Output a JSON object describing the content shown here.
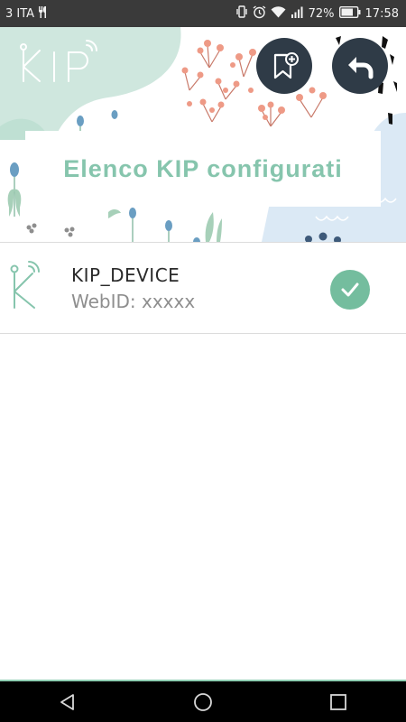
{
  "status_bar": {
    "carrier": "3 ITA",
    "battery": "72%",
    "time": "17:58"
  },
  "header": {
    "logo_text": "KIP",
    "title": "Elenco KIP configurati"
  },
  "devices": [
    {
      "name": "KIP_DEVICE",
      "webid_label": "WebID:",
      "webid_value": "xxxxx",
      "configured": true
    }
  ],
  "colors": {
    "accent": "#86c5ad",
    "check": "#74bd9e",
    "button_bg": "#2f3b47",
    "status_bar": "#3a3a3a"
  },
  "icons": {
    "add_bookmark": "bookmark-add-icon",
    "back": "back-arrow-icon",
    "check": "check-icon",
    "nav_back": "nav-back-icon",
    "nav_home": "nav-home-icon",
    "nav_recent": "nav-recent-icon"
  }
}
